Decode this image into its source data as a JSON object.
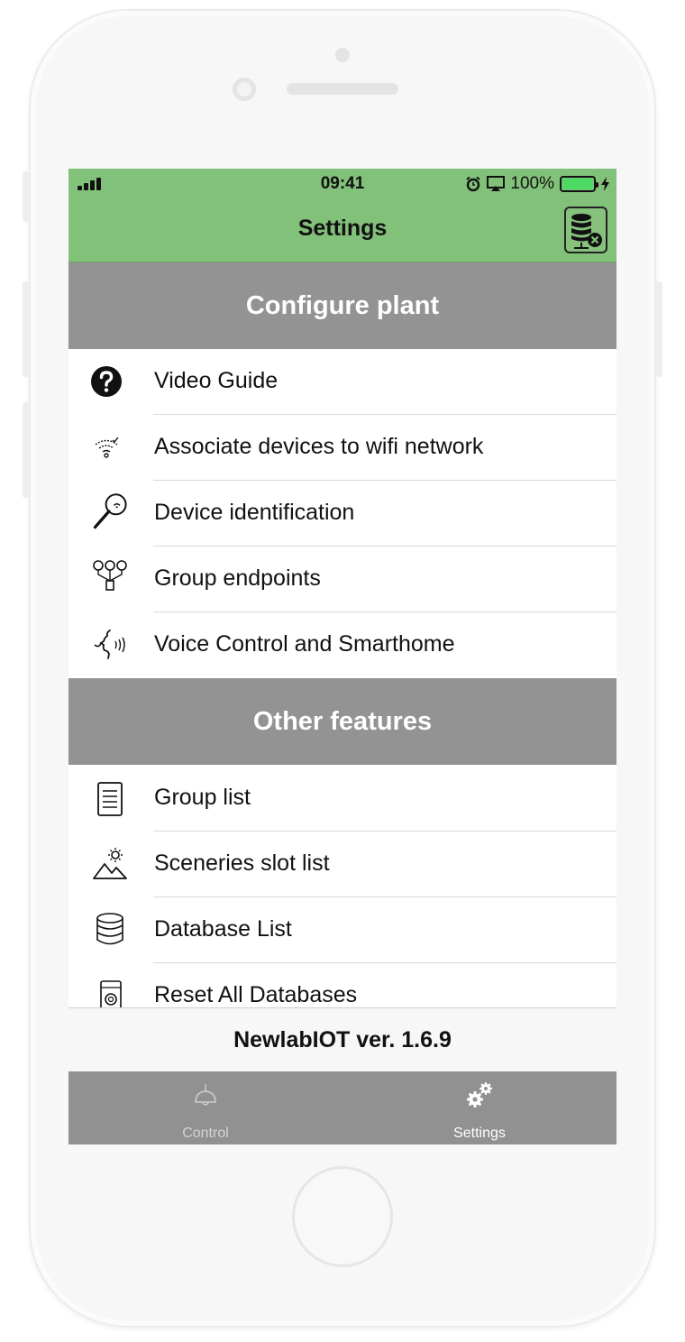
{
  "status_bar": {
    "time": "09:41",
    "battery": "100%",
    "battery_level": 1.0
  },
  "nav": {
    "title": "Settings",
    "right_button_icon": "database-remove-icon"
  },
  "sections": [
    {
      "title": "Configure plant",
      "items": [
        {
          "label": "Video Guide",
          "icon": "question-circle-icon"
        },
        {
          "label": "Associate devices to wifi network",
          "icon": "wifi-check-icon"
        },
        {
          "label": "Device identification",
          "icon": "magnifier-icon"
        },
        {
          "label": "Group endpoints",
          "icon": "group-bulbs-icon"
        },
        {
          "label": "Voice Control and Smarthome",
          "icon": "voice-icon"
        }
      ]
    },
    {
      "title": "Other features",
      "items": [
        {
          "label": "Group list",
          "icon": "list-icon"
        },
        {
          "label": "Sceneries slot list",
          "icon": "scenery-icon"
        },
        {
          "label": "Database List",
          "icon": "database-icon"
        },
        {
          "label": "Reset All Databases",
          "icon": "reset-device-icon"
        }
      ]
    }
  ],
  "version": "NewlabIOT ver. 1.6.9",
  "tabs": [
    {
      "label": "Control",
      "icon": "lamp-icon",
      "active": false
    },
    {
      "label": "Settings",
      "icon": "gears-icon",
      "active": true
    }
  ],
  "colors": {
    "header_green": "#82c17a",
    "section_gray": "#939393",
    "tab_bar_gray": "#919191"
  }
}
